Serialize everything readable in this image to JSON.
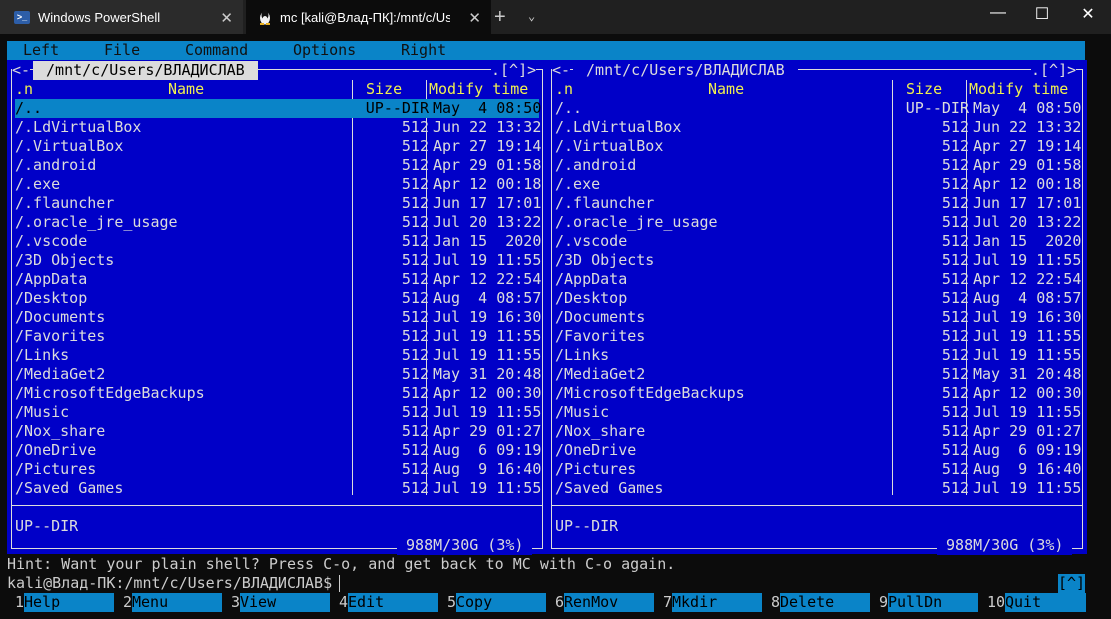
{
  "window": {
    "tabs": [
      {
        "label": "Windows PowerShell",
        "icon": "powershell-icon"
      },
      {
        "label": "mc [kali@Влад-ПК]:/mnt/c/User",
        "icon": "linux-penguin-icon"
      }
    ],
    "new_tab": "+",
    "dropdown": "⌄",
    "close_glyph": "✕",
    "controls": {
      "minimize": "—",
      "maximize": "☐",
      "close": "✕"
    }
  },
  "menu": [
    "Left",
    "File",
    "Command",
    "Options",
    "Right"
  ],
  "left_panel": {
    "corner_left": "<-",
    "path": " /mnt/c/Users/ВЛАДИСЛАВ ",
    "corner_right": ".[^]>",
    "sort_indicator": ".n",
    "col_name": "Name",
    "col_size": "Size",
    "col_modify": "Modify time",
    "mini_status": "UP--DIR",
    "disk_info": " 988M/30G (3%) "
  },
  "right_panel": {
    "corner_left": "<-",
    "path": " /mnt/c/Users/ВЛАДИСЛАВ ",
    "corner_right": ".[^]>",
    "sort_indicator": ".n",
    "col_name": "Name",
    "col_size": "Size",
    "col_modify": "Modify time",
    "mini_status": "UP--DIR",
    "disk_info": " 988M/30G (3%) "
  },
  "files": [
    {
      "name": "/..",
      "size": "UP--DIR",
      "date": "May  4 08:50"
    },
    {
      "name": "/.LdVirtualBox",
      "size": "512",
      "date": "Jun 22 13:32"
    },
    {
      "name": "/.VirtualBox",
      "size": "512",
      "date": "Apr 27 19:14"
    },
    {
      "name": "/.android",
      "size": "512",
      "date": "Apr 29 01:58"
    },
    {
      "name": "/.exe",
      "size": "512",
      "date": "Apr 12 00:18"
    },
    {
      "name": "/.flauncher",
      "size": "512",
      "date": "Jun 17 17:01"
    },
    {
      "name": "/.oracle_jre_usage",
      "size": "512",
      "date": "Jul 20 13:22"
    },
    {
      "name": "/.vscode",
      "size": "512",
      "date": "Jan 15  2020"
    },
    {
      "name": "/3D Objects",
      "size": "512",
      "date": "Jul 19 11:55"
    },
    {
      "name": "/AppData",
      "size": "512",
      "date": "Apr 12 22:54"
    },
    {
      "name": "/Desktop",
      "size": "512",
      "date": "Aug  4 08:57"
    },
    {
      "name": "/Documents",
      "size": "512",
      "date": "Jul 19 16:30"
    },
    {
      "name": "/Favorites",
      "size": "512",
      "date": "Jul 19 11:55"
    },
    {
      "name": "/Links",
      "size": "512",
      "date": "Jul 19 11:55"
    },
    {
      "name": "/MediaGet2",
      "size": "512",
      "date": "May 31 20:48"
    },
    {
      "name": "/MicrosoftEdgeBackups",
      "size": "512",
      "date": "Apr 12 00:30"
    },
    {
      "name": "/Music",
      "size": "512",
      "date": "Jul 19 11:55"
    },
    {
      "name": "/Nox_share",
      "size": "512",
      "date": "Apr 29 01:27"
    },
    {
      "name": "/OneDrive",
      "size": "512",
      "date": "Aug  6 09:19"
    },
    {
      "name": "/Pictures",
      "size": "512",
      "date": "Aug  9 16:40"
    },
    {
      "name": "/Saved Games",
      "size": "512",
      "date": "Jul 19 11:55"
    }
  ],
  "hint": "Hint: Want your plain shell? Press C-o, and get back to MC with C-o again.",
  "prompt": "kali@Влад-ПК:/mnt/c/Users/ВЛАДИСЛАВ$ ",
  "caret_badge": "[^]",
  "fkeys": [
    {
      "num": "1",
      "label": "Help"
    },
    {
      "num": "2",
      "label": "Menu"
    },
    {
      "num": "3",
      "label": "View"
    },
    {
      "num": "4",
      "label": "Edit"
    },
    {
      "num": "5",
      "label": "Copy"
    },
    {
      "num": "6",
      "label": "RenMov"
    },
    {
      "num": "7",
      "label": "Mkdir"
    },
    {
      "num": "8",
      "label": "Delete"
    },
    {
      "num": "9",
      "label": "PullDn"
    },
    {
      "num": "10",
      "label": "Quit"
    }
  ],
  "colors": {
    "panel_bg": "#0000c8",
    "accent_cyan": "#0a84c8",
    "header_yellow": "#f0f050",
    "text": "#dcdcdc"
  }
}
